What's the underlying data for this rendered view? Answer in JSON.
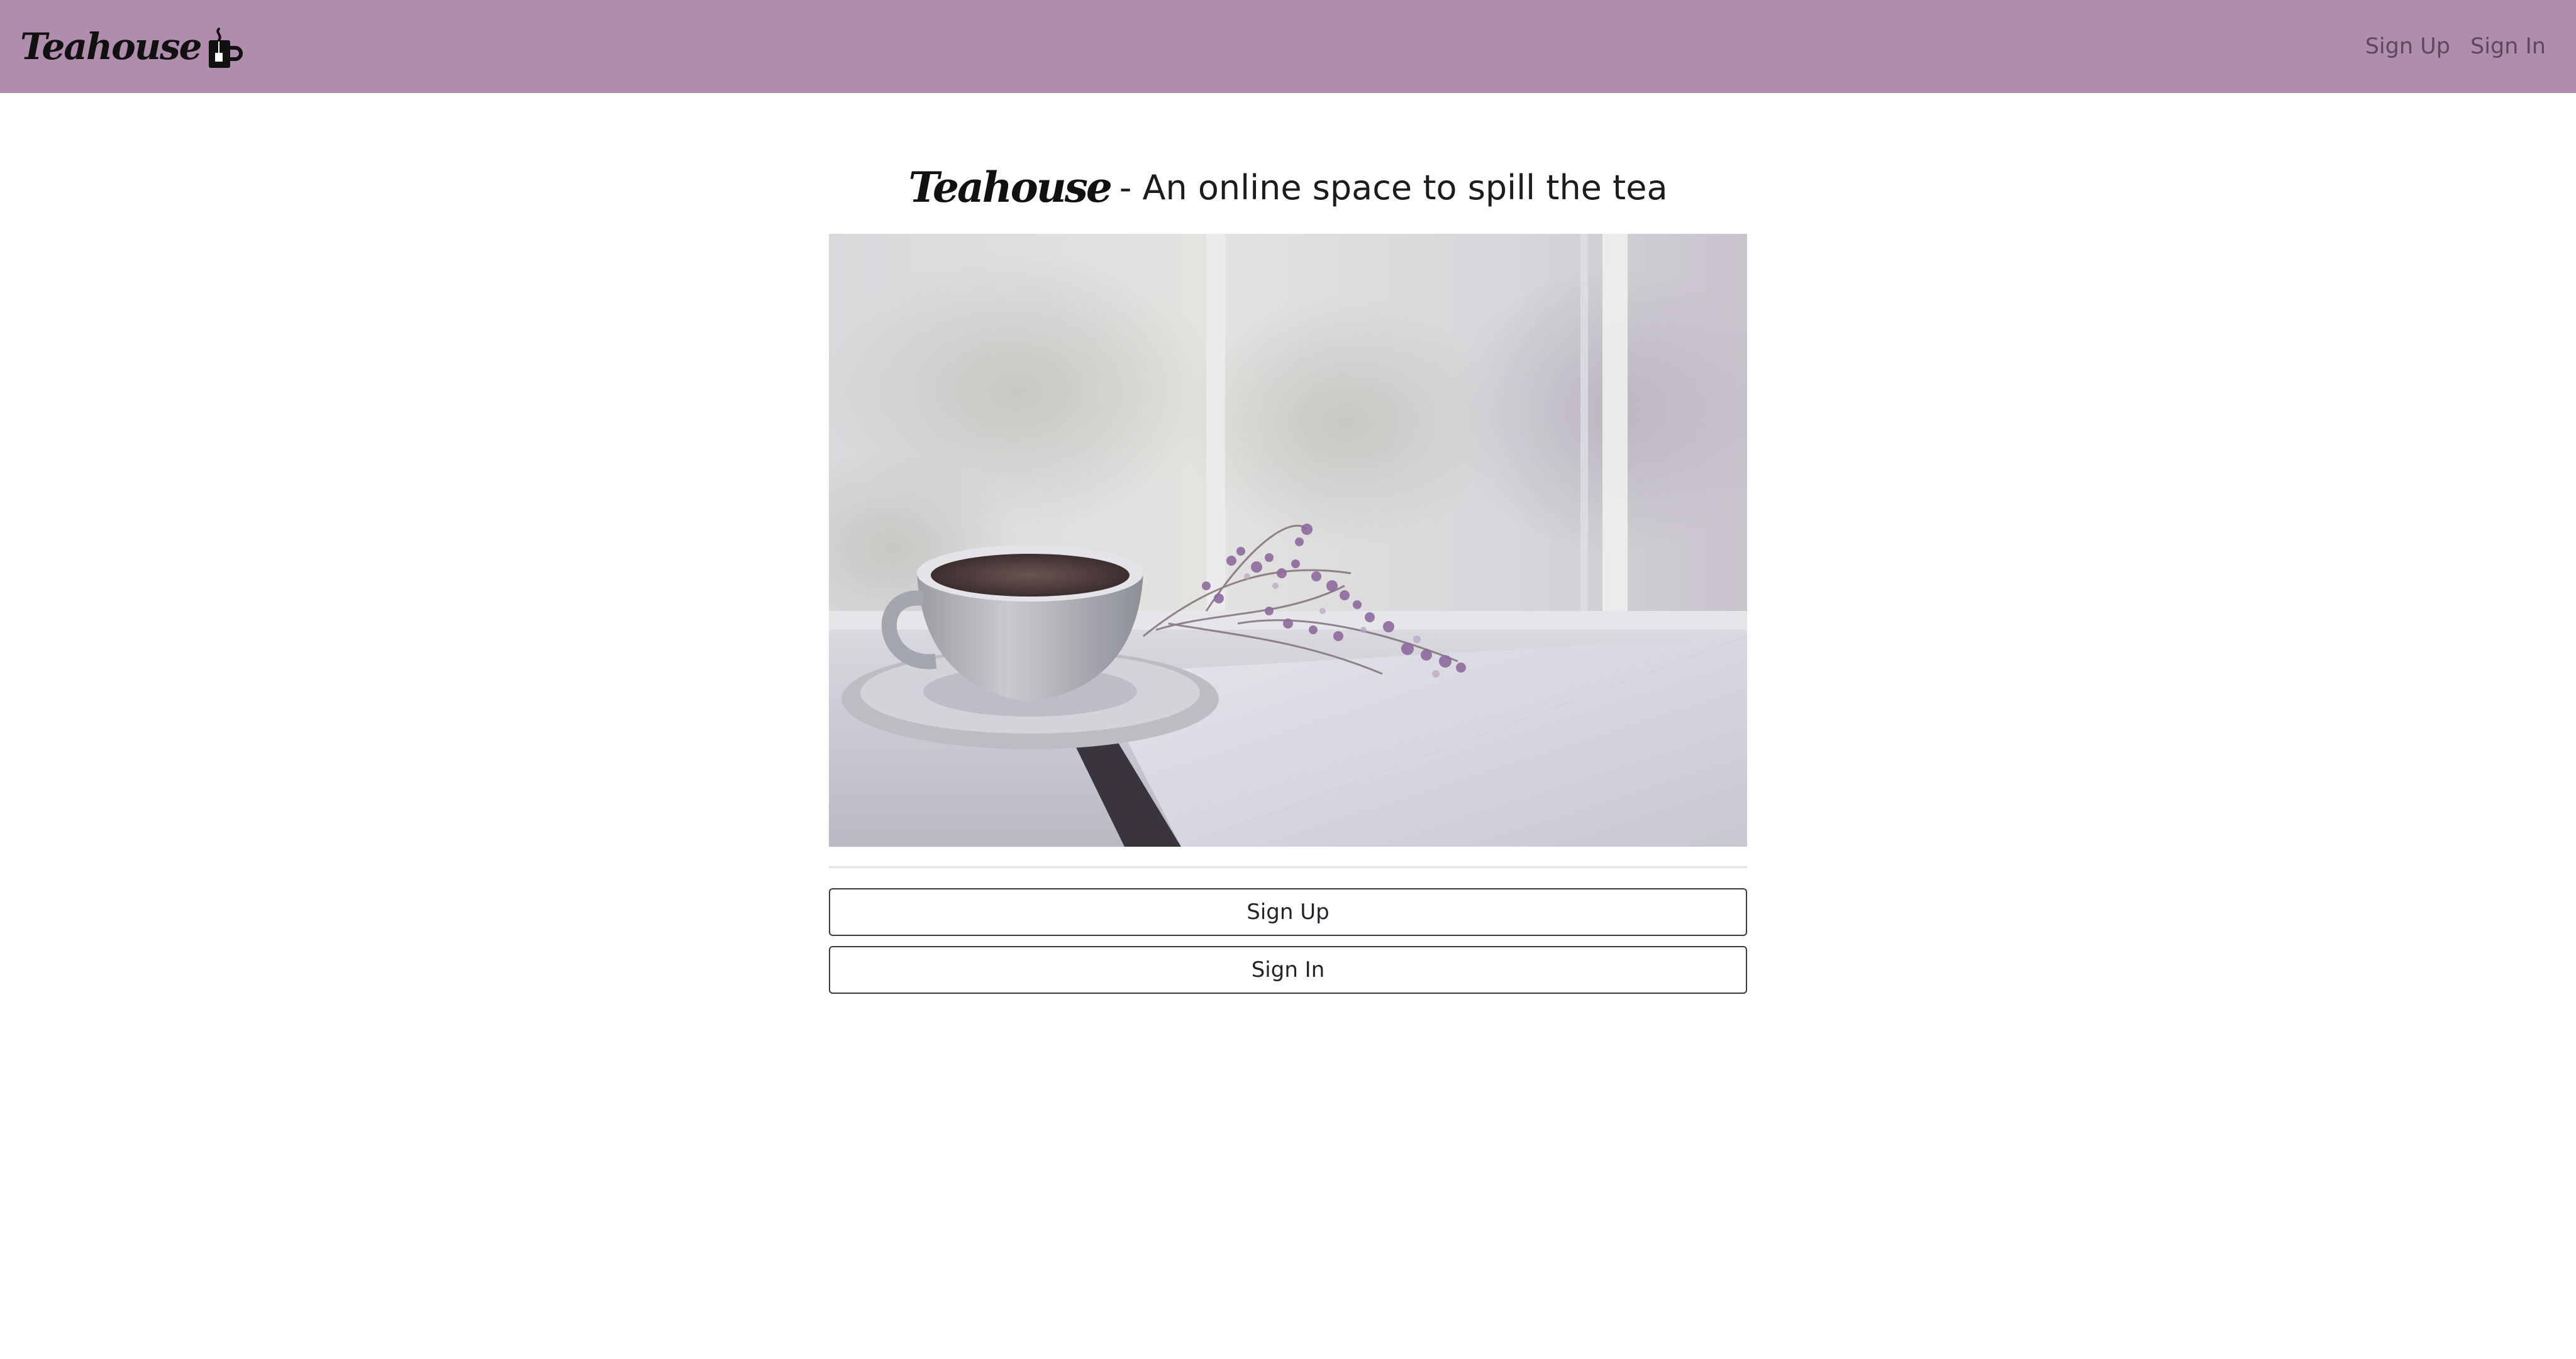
{
  "navbar": {
    "brand": "Teahouse",
    "brand_icon": "tea-mug-icon",
    "links": [
      {
        "label": "Sign Up"
      },
      {
        "label": "Sign In"
      }
    ],
    "background_color": "#b08cad"
  },
  "main": {
    "headline_brand": "Teahouse",
    "headline_rest": "- An online space to spill the tea",
    "hero_image": "tea-cup-book-flowers-photo",
    "buttons": {
      "sign_up": "Sign Up",
      "sign_in": "Sign In"
    }
  }
}
